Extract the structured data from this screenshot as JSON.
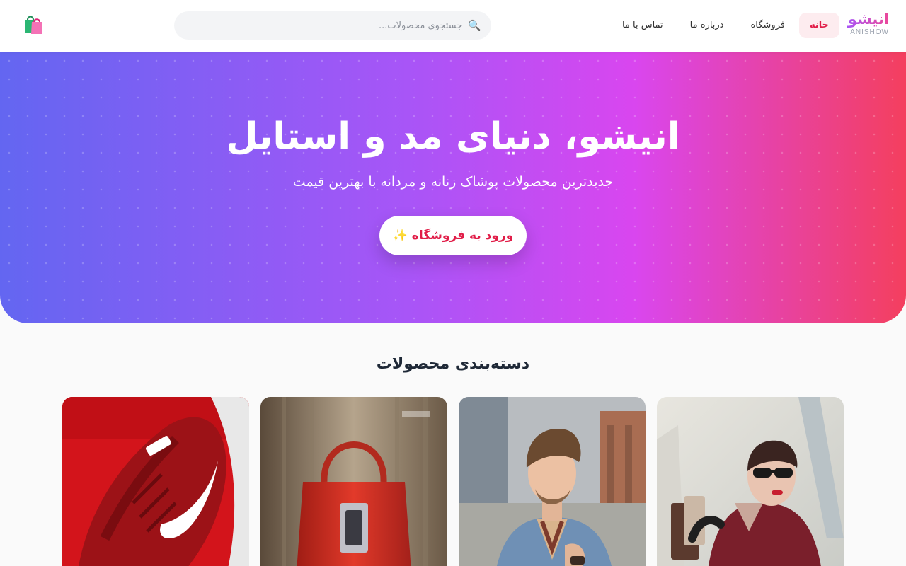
{
  "brand": {
    "name": "انیشو",
    "latin": "ANISHOW"
  },
  "nav": {
    "items": [
      {
        "label": "خانه",
        "active": true
      },
      {
        "label": "فروشگاه",
        "active": false
      },
      {
        "label": "درباره ما",
        "active": false
      },
      {
        "label": "تماس با ما",
        "active": false
      }
    ]
  },
  "search": {
    "placeholder": "جستجوی محصولات...",
    "value": "",
    "icon": "search-icon"
  },
  "cart": {
    "icon": "shopping-bags-icon"
  },
  "hero": {
    "title": "انیشو، دنیای مد و استایل",
    "subtitle": "جدیدترین محصولات پوشاک زنانه و مردانه با بهترین قیمت",
    "button_label": "ورود به فروشگاه ✨",
    "colors": {
      "start": "#6366f1",
      "mid": "#a855f7",
      "end": "#f43f5e"
    }
  },
  "categories": {
    "title": "دسته‌بندی محصولات",
    "cards": [
      {
        "name": "women-category-card",
        "image": "woman-with-sunglasses-and-shopping-bags"
      },
      {
        "name": "men-category-card",
        "image": "man-in-denim-jacket"
      },
      {
        "name": "bags-category-card",
        "image": "red-leather-handbag"
      },
      {
        "name": "shoes-category-card",
        "image": "red-nike-sneaker"
      }
    ]
  },
  "colors": {
    "accent": "#e11d48",
    "accent_bg": "#fdecef"
  }
}
